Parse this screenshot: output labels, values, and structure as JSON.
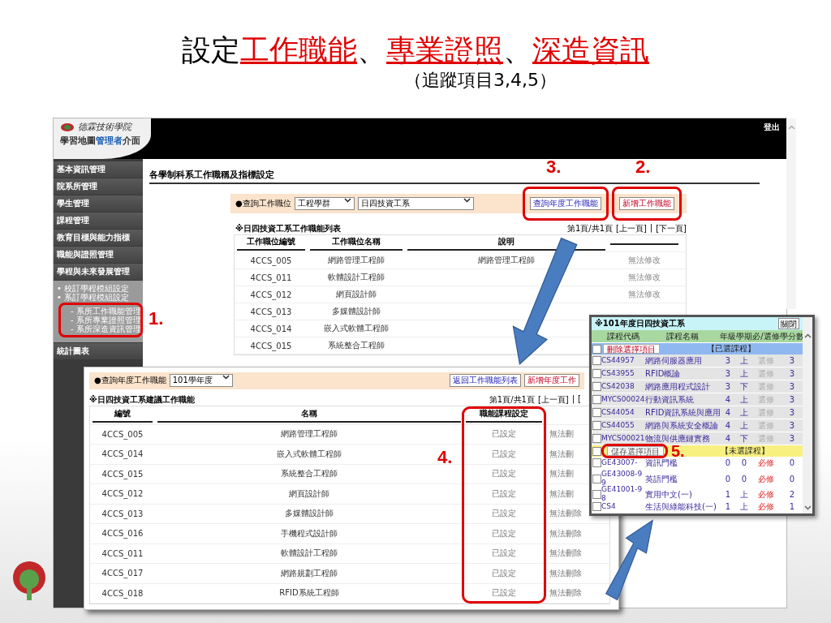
{
  "slide_title": [
    {
      "text": "設定",
      "highlight": false
    },
    {
      "text": "工作職能",
      "highlight": true
    },
    {
      "text": "、",
      "highlight": false
    },
    {
      "text": "專業證照",
      "highlight": true
    },
    {
      "text": "、",
      "highlight": false
    },
    {
      "text": "深造資訊",
      "highlight": true
    }
  ],
  "slide_subtitle": "（追蹤項目3,4,5）",
  "app": {
    "school_name": "德霖技術學院",
    "portal_title": [
      {
        "text": "學習地圖",
        "accent": false
      },
      {
        "text": "管理者",
        "accent": true
      },
      {
        "text": "介面",
        "accent": false
      }
    ],
    "logout": "登出",
    "sidebar": [
      {
        "label": "基本資訊管理"
      },
      {
        "label": "院系所管理"
      },
      {
        "label": "學生管理"
      },
      {
        "label": "課程管理"
      },
      {
        "label": "教育目標與能力指標"
      },
      {
        "label": "職能與證照管理"
      },
      {
        "label": "學程與未來發展管理",
        "expanded": true,
        "children": [
          {
            "label": "• 校訂學程模組設定"
          },
          {
            "label": "• 系訂學程模組設定"
          },
          {
            "label": "- 系所工作職能管理"
          },
          {
            "label": "- 系所專業證照管理"
          },
          {
            "label": "- 系所深造資訊管理"
          }
        ]
      },
      {
        "label": "統計圖表"
      }
    ],
    "page_title": "各學制科系工作職稱及指標設定",
    "filter": {
      "label": "●查詢工作職位",
      "selects": [
        "工程學群",
        "日四技資工系"
      ],
      "buttons": [
        {
          "label": "查詢年度工作職能",
          "kind": "query"
        },
        {
          "label": "新增工作職能",
          "kind": "add"
        }
      ]
    },
    "table": {
      "caption": "※日四技資工系工作職能列表",
      "pager": {
        "text": "第1頁/共1頁",
        "links": [
          "[上一頁]",
          "[下一頁]"
        ],
        "separator": "|"
      },
      "columns": [
        "工作職位編號",
        "工作職位名稱",
        "說明"
      ],
      "rows": [
        {
          "code": "4CCS_005",
          "name": "網路管理工程師",
          "description": "網路管理工程師",
          "status": "無法修改"
        },
        {
          "code": "4CCS_011",
          "name": "軟體設計工程師",
          "status": "無法修改"
        },
        {
          "code": "4CCS_012",
          "name": "網頁設計師",
          "status": "無法修改"
        },
        {
          "code": "4CCS_013",
          "name": "多媒體設計師"
        },
        {
          "code": "4CCS_014",
          "name": "嵌入式軟體工程師"
        },
        {
          "code": "4CCS_015",
          "name": "系統整合工程師"
        }
      ]
    }
  },
  "yearly_panel": {
    "filter": {
      "label": "●查詢年度工作職能",
      "select": "101學年度",
      "buttons": [
        {
          "label": "返回工作職能列表",
          "kind": "query"
        },
        {
          "label": "新增年度工作",
          "kind": "add"
        }
      ]
    },
    "caption": "※日四技資工系建議工作職能",
    "pager": {
      "text": "第1頁/共1頁",
      "links": [
        "[上一頁]",
        "["
      ],
      "separator": "|"
    },
    "columns": [
      "編號",
      "名稱",
      "職能課程設定"
    ],
    "rows": [
      {
        "code": "4CCS_005",
        "name": "網路管理工程師",
        "setting": "已設定",
        "action": "無法刪"
      },
      {
        "code": "4CCS_014",
        "name": "嵌入式軟體工程師",
        "setting": "已設定",
        "action": "無法刪"
      },
      {
        "code": "4CCS_015",
        "name": "系統整合工程師",
        "setting": "已設定",
        "action": "無法刪"
      },
      {
        "code": "4CCS_012",
        "name": "網頁設計師",
        "setting": "已設定",
        "action": "無法刪"
      },
      {
        "code": "4CCS_013",
        "name": "多媒體設計師",
        "setting": "已設定",
        "action": "無法刪除"
      },
      {
        "code": "4CCS_016",
        "name": "手機程式設計師",
        "setting": "已設定",
        "action": "無法刪除"
      },
      {
        "code": "4CCS_011",
        "name": "軟體設計工程師",
        "setting": "已設定",
        "action": "無法刪除"
      },
      {
        "code": "4CCS_017",
        "name": "網路規劃工程師",
        "setting": "已設定",
        "action": "無法刪除"
      },
      {
        "code": "4CCS_018",
        "name": "RFID系統工程師",
        "setting": "已設定",
        "action": "無法刪除"
      }
    ]
  },
  "course_window": {
    "title": "※101年度日四技資工系",
    "close": "關閉",
    "columns": [
      "課程代碼",
      "課程名稱",
      "年級",
      "學期",
      "必/選修",
      "學分數"
    ],
    "sections": [
      {
        "button": "刪除選擇項目",
        "label": "【已選課程】",
        "kind": "chosen",
        "checked": false,
        "rows": [
          {
            "code": "CS44957",
            "name": "網路伺服器應用",
            "grade": "3",
            "term": "上",
            "type": "選修",
            "required": false,
            "credits": "3",
            "checked": false
          },
          {
            "code": "CS43955",
            "name": "RFID概論",
            "grade": "3",
            "term": "上",
            "type": "選修",
            "required": false,
            "credits": "3",
            "checked": false
          },
          {
            "code": "CS42038",
            "name": "網路應用程式設計",
            "grade": "3",
            "term": "下",
            "type": "選修",
            "required": false,
            "credits": "3",
            "checked": false
          },
          {
            "code": "MYCS00024",
            "name": "行動資訊系統",
            "grade": "4",
            "term": "上",
            "type": "選修",
            "required": false,
            "credits": "3",
            "checked": false
          },
          {
            "code": "CS44054",
            "name": "RFID資訊系統與應用",
            "grade": "4",
            "term": "上",
            "type": "選修",
            "required": false,
            "credits": "3",
            "checked": false
          },
          {
            "code": "CS44055",
            "name": "網路與系統安全概論",
            "grade": "4",
            "term": "上",
            "type": "選修",
            "required": false,
            "credits": "3",
            "checked": false
          },
          {
            "code": "MYCS00021",
            "name": "物流與供應鏈實務",
            "grade": "4",
            "term": "下",
            "type": "選修",
            "required": false,
            "credits": "3",
            "checked": false
          }
        ]
      },
      {
        "button": "儲存選擇項目",
        "label": "【未選課程】",
        "kind": "open",
        "checked": false,
        "rows": [
          {
            "code": "GE43007-",
            "name": "資訊門檻",
            "grade": "0",
            "term": "0",
            "type": "必修",
            "required": true,
            "credits": "0",
            "checked": false
          },
          {
            "code": "GE43008-99",
            "name": "英語門檻",
            "grade": "0",
            "term": "0",
            "type": "必修",
            "required": true,
            "credits": "0",
            "checked": false
          },
          {
            "code": "GE41001-98",
            "name": "實用中文(一)",
            "grade": "1",
            "term": "上",
            "type": "必修",
            "required": true,
            "credits": "2",
            "checked": false
          },
          {
            "code": "CS4",
            "name": "生活與綠能科技(一)",
            "grade": "1",
            "term": "上",
            "type": "必修",
            "required": true,
            "credits": "1",
            "checked": false
          }
        ]
      }
    ]
  },
  "callouts": [
    {
      "label": "1."
    },
    {
      "label": "3."
    },
    {
      "label": "2."
    },
    {
      "label": "4."
    },
    {
      "label": "5."
    }
  ]
}
